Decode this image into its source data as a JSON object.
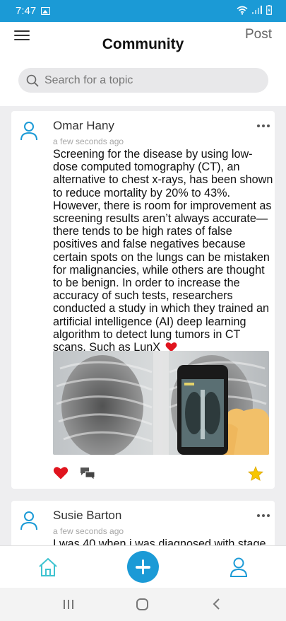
{
  "status_bar": {
    "time": "7:47"
  },
  "header": {
    "title": "Community",
    "post_label": "Post"
  },
  "search": {
    "placeholder": "Search for a topic"
  },
  "posts": [
    {
      "author": "Omar Hany",
      "time_ago": "a few seconds ago",
      "text": "Screening for the disease by using low-dose computed tomography (CT), an alternative to chest x-rays, has been shown to reduce mortality by 20% to 43%. However, there is room for improvement as screening results aren’t always accurate—there tends to be high rates of false positives and false negatives because certain spots on the lungs can be mistaken for malignancies, while others are thought to be benign. In order to increase the accuracy of such tests, researchers conducted a study in which they trained an artificial intelligence (AI) deep learning algorithm to detect lung tumors in CT scans. Such as LunX",
      "liked": true,
      "starred": true
    },
    {
      "author": "Susie Barton",
      "time_ago": "a few seconds ago",
      "text": "I was 40 when i was diagnosed with stage"
    }
  ],
  "colors": {
    "accent": "#1b9ad6",
    "like": "#e0141e",
    "star": "#f7c600"
  },
  "icons": {
    "menu": "hamburger-icon",
    "search": "search-icon",
    "avatar": "user-icon",
    "more": "more-dots-icon",
    "like": "heart-icon",
    "comment": "comment-icon",
    "favorite": "star-icon",
    "home": "home-icon",
    "add": "plus-icon",
    "profile": "profile-icon"
  }
}
